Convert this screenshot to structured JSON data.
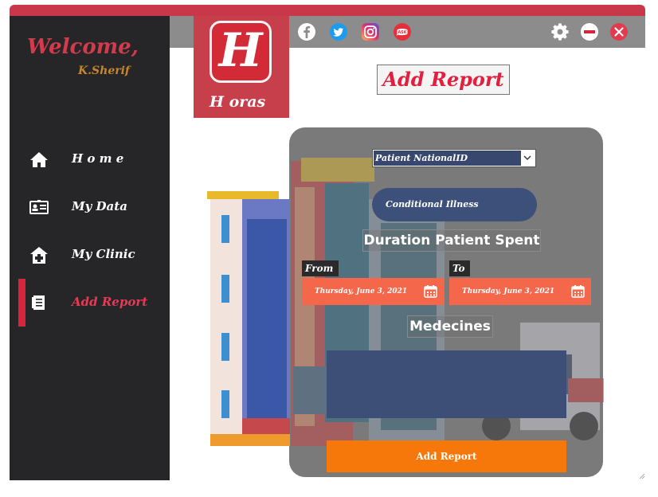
{
  "sidebar": {
    "welcome": "Welcome,",
    "username": "K.Sherif",
    "items": [
      {
        "label": "H o m e",
        "icon": "home-icon"
      },
      {
        "label": "My Data",
        "icon": "id-card-icon"
      },
      {
        "label": "My Clinic",
        "icon": "clinic-icon"
      },
      {
        "label": "Add Report",
        "icon": "report-icon",
        "active": true
      }
    ]
  },
  "logo": {
    "letter": "H",
    "name": "H oras"
  },
  "header": {
    "social_icons": [
      "facebook-icon",
      "twitter-icon",
      "instagram-icon",
      "ask-fm-icon"
    ],
    "controls": [
      "settings-icon",
      "minimize-icon",
      "close-icon"
    ]
  },
  "page": {
    "title": "Add Report"
  },
  "form": {
    "patient_select": {
      "value": "Patient NationalID"
    },
    "conditional_illness": "Conditional Illness",
    "duration_heading": "Duration Patient Spent",
    "from_label": "From",
    "to_label": "To",
    "from_date": "Thursday, June 3, 2021",
    "to_date": "Thursday, June 3, 2021",
    "medicines_heading": "Medecines",
    "medicines_value": "",
    "submit_label": "Add Report"
  },
  "colors": {
    "accent_red": "#d23b4c",
    "sidebar_bg": "#262527",
    "date_orange": "#f4674b",
    "button_orange": "#f7780a",
    "field_blue": "#3d4f77"
  }
}
